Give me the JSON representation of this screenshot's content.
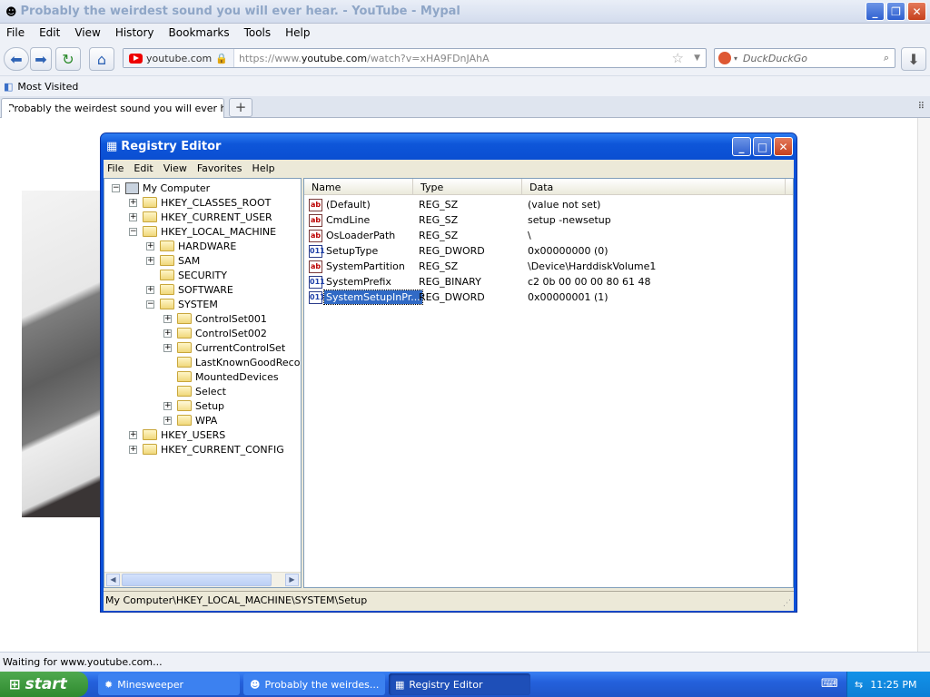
{
  "browser": {
    "title": "Probably the weirdest sound you will ever hear. - YouTube - Mypal",
    "menu": [
      "File",
      "Edit",
      "View",
      "History",
      "Bookmarks",
      "Tools",
      "Help"
    ],
    "site_identity": "youtube.com",
    "url_prefix": "https://www.",
    "url_domain": "youtube.com",
    "url_path": "/watch?v=xHA9FDnJAhA",
    "search_engine": "DuckDuckGo",
    "bookmark": "Most Visited",
    "tab_title": "Probably the weirdest sound you will ever h...",
    "status": "Waiting for www.youtube.com..."
  },
  "registry": {
    "title": "Registry Editor",
    "menu": [
      "File",
      "Edit",
      "View",
      "Favorites",
      "Help"
    ],
    "tree": [
      {
        "label": "My Computer",
        "depth": 0,
        "toggle": "-",
        "icon": "computer"
      },
      {
        "label": "HKEY_CLASSES_ROOT",
        "depth": 1,
        "toggle": "+",
        "icon": "folder"
      },
      {
        "label": "HKEY_CURRENT_USER",
        "depth": 1,
        "toggle": "+",
        "icon": "folder"
      },
      {
        "label": "HKEY_LOCAL_MACHINE",
        "depth": 1,
        "toggle": "-",
        "icon": "folder"
      },
      {
        "label": "HARDWARE",
        "depth": 2,
        "toggle": "+",
        "icon": "folder"
      },
      {
        "label": "SAM",
        "depth": 2,
        "toggle": "+",
        "icon": "folder"
      },
      {
        "label": "SECURITY",
        "depth": 2,
        "toggle": "",
        "icon": "folder"
      },
      {
        "label": "SOFTWARE",
        "depth": 2,
        "toggle": "+",
        "icon": "folder"
      },
      {
        "label": "SYSTEM",
        "depth": 2,
        "toggle": "-",
        "icon": "folder"
      },
      {
        "label": "ControlSet001",
        "depth": 3,
        "toggle": "+",
        "icon": "folder"
      },
      {
        "label": "ControlSet002",
        "depth": 3,
        "toggle": "+",
        "icon": "folder"
      },
      {
        "label": "CurrentControlSet",
        "depth": 3,
        "toggle": "+",
        "icon": "folder"
      },
      {
        "label": "LastKnownGoodRecove",
        "depth": 3,
        "toggle": "",
        "icon": "folder"
      },
      {
        "label": "MountedDevices",
        "depth": 3,
        "toggle": "",
        "icon": "folder"
      },
      {
        "label": "Select",
        "depth": 3,
        "toggle": "",
        "icon": "folder"
      },
      {
        "label": "Setup",
        "depth": 3,
        "toggle": "+",
        "icon": "folder-open"
      },
      {
        "label": "WPA",
        "depth": 3,
        "toggle": "+",
        "icon": "folder"
      },
      {
        "label": "HKEY_USERS",
        "depth": 1,
        "toggle": "+",
        "icon": "folder"
      },
      {
        "label": "HKEY_CURRENT_CONFIG",
        "depth": 1,
        "toggle": "+",
        "icon": "folder"
      }
    ],
    "columns": [
      "Name",
      "Type",
      "Data"
    ],
    "values": [
      {
        "name": "(Default)",
        "type": "REG_SZ",
        "data": "(value not set)",
        "icon": "string"
      },
      {
        "name": "CmdLine",
        "type": "REG_SZ",
        "data": "setup -newsetup",
        "icon": "string"
      },
      {
        "name": "OsLoaderPath",
        "type": "REG_SZ",
        "data": "\\",
        "icon": "string"
      },
      {
        "name": "SetupType",
        "type": "REG_DWORD",
        "data": "0x00000000 (0)",
        "icon": "binary"
      },
      {
        "name": "SystemPartition",
        "type": "REG_SZ",
        "data": "\\Device\\HarddiskVolume1",
        "icon": "string"
      },
      {
        "name": "SystemPrefix",
        "type": "REG_BINARY",
        "data": "c2 0b 00 00 00 80 61 48",
        "icon": "binary"
      },
      {
        "name": "SystemSetupInPr...",
        "type": "REG_DWORD",
        "data": "0x00000001 (1)",
        "icon": "binary",
        "selected": true
      }
    ],
    "status": "My Computer\\HKEY_LOCAL_MACHINE\\SYSTEM\\Setup"
  },
  "taskbar": {
    "start": "start",
    "items": [
      "Minesweeper",
      "Probably the weirdes...",
      "Registry Editor"
    ],
    "clock": "11:25 PM"
  }
}
